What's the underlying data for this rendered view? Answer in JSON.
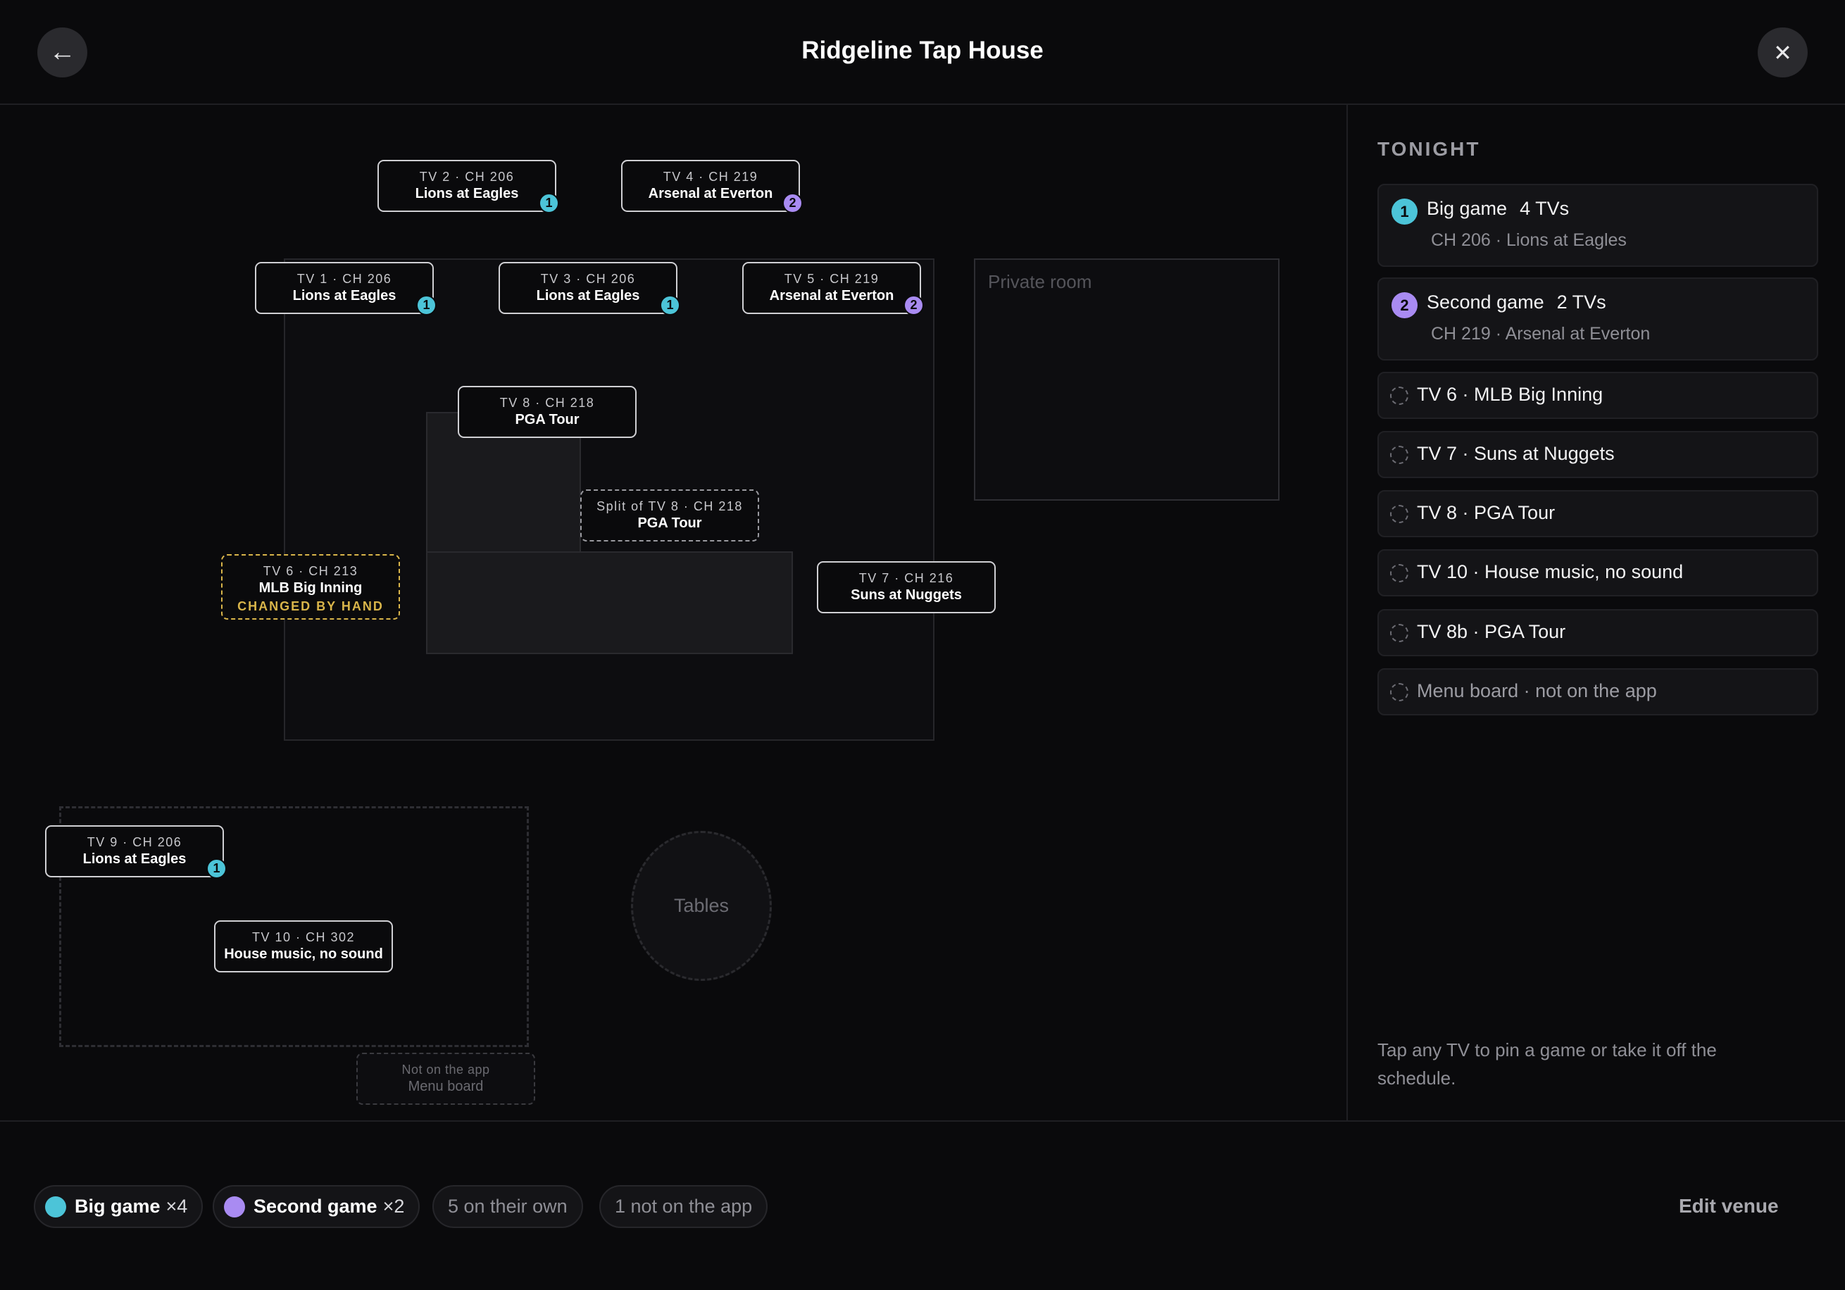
{
  "header": {
    "title": "Ridgeline Tap House",
    "back_icon": "←",
    "close_icon": "✕"
  },
  "colors": {
    "big_game": "#4cc4d8",
    "second_game": "#a98bf2",
    "changed_by_hand": "#d9b54a"
  },
  "map": {
    "private_room": "Private room",
    "tables": "Tables",
    "tvs": [
      {
        "id": "tv2",
        "line1": "TV 2 · CH 206",
        "line2": "Lions at Eagles",
        "badge": "1"
      },
      {
        "id": "tv4",
        "line1": "TV 4 · CH 219",
        "line2": "Arsenal at Everton",
        "badge": "2"
      },
      {
        "id": "tv1",
        "line1": "TV 1 · CH 206",
        "line2": "Lions at Eagles",
        "badge": "1"
      },
      {
        "id": "tv3",
        "line1": "TV 3 · CH 206",
        "line2": "Lions at Eagles",
        "badge": "1"
      },
      {
        "id": "tv5",
        "line1": "TV 5 · CH 219",
        "line2": "Arsenal at Everton",
        "badge": "2"
      },
      {
        "id": "tv8",
        "line1": "TV 8 · CH 218",
        "line2": "PGA Tour"
      },
      {
        "id": "tv8b",
        "line1": "Split of TV 8 · CH 218",
        "line2": "PGA Tour"
      },
      {
        "id": "tv6",
        "line1": "TV 6 · CH 213",
        "line2": "MLB Big Inning",
        "line3": "CHANGED BY HAND"
      },
      {
        "id": "tv7",
        "line1": "TV 7 · CH 216",
        "line2": "Suns at Nuggets"
      },
      {
        "id": "tv9",
        "line1": "TV 9 · CH 206",
        "line2": "Lions at Eagles",
        "badge": "1"
      },
      {
        "id": "tv10",
        "line1": "TV 10 · CH 302",
        "line2": "House music, no sound"
      },
      {
        "id": "menu",
        "line1": "Not on the app",
        "line2": "Menu board"
      }
    ]
  },
  "side": {
    "heading": "TONIGHT",
    "groups": [
      {
        "num": "1",
        "name": "Big game",
        "count": "4 TVs",
        "detail": "CH 206 · Lions at Eagles"
      },
      {
        "num": "2",
        "name": "Second game",
        "count": "2 TVs",
        "detail": "CH 219 · Arsenal at Everton"
      }
    ],
    "singles": [
      "TV 6 · MLB Big Inning",
      "TV 7 · Suns at Nuggets",
      "TV 8 · PGA Tour",
      "TV 10 · House music, no sound",
      "TV 8b · PGA Tour",
      "Menu board · not on the app"
    ],
    "hint": "Tap any TV to pin a game or take it off the schedule."
  },
  "footer": {
    "chips": [
      {
        "label": "Big game",
        "mult": "×4"
      },
      {
        "label": "Second game",
        "mult": "×2"
      },
      {
        "label": "5 on their own"
      },
      {
        "label": "1 not on the app"
      }
    ],
    "edit": "Edit venue"
  }
}
